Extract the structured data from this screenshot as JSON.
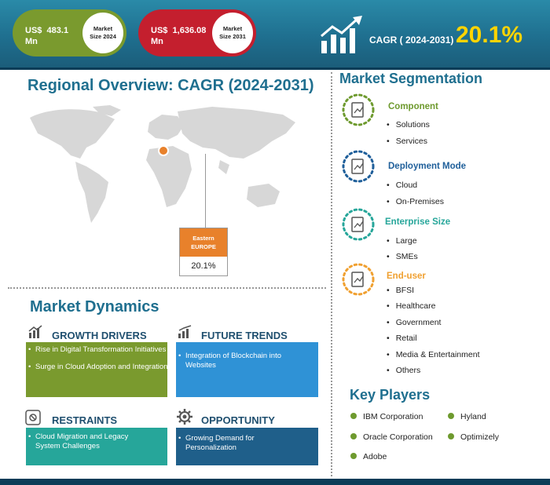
{
  "header": {
    "market_2024": {
      "currency": "US$",
      "value": "483.1",
      "unit": "Mn",
      "label_line1": "Market",
      "label_line2": "Size 2024"
    },
    "market_2031": {
      "currency": "US$",
      "value": "1,636.08",
      "unit": "Mn",
      "label_line1": "Market",
      "label_line2": "Size 2031"
    },
    "cagr_label": "CAGR ( 2024-2031)",
    "cagr_value": "20.1%"
  },
  "regional": {
    "title": "Regional Overview: CAGR (2024-2031)",
    "region_line1": "Eastern",
    "region_line2": "EUROPE",
    "region_cagr": "20.1%"
  },
  "dynamics": {
    "title": "Market Dynamics",
    "growth_drivers": {
      "heading": "GROWTH DRIVERS",
      "items": [
        "Rise in Digital Transformation Initiatives",
        "Surge in Cloud Adoption and Integration"
      ]
    },
    "future_trends": {
      "heading": "FUTURE TRENDS",
      "item_line1": "Integration of Blockchain into",
      "item_line2": "Websites"
    },
    "restraints": {
      "heading": "RESTRAINTS",
      "item_line1": "Cloud Migration and Legacy",
      "item_line2": "System Challenges"
    },
    "opportunity": {
      "heading": "OPPORTUNITY",
      "item_line1": "Growing Demand for",
      "item_line2": "Personalization"
    }
  },
  "segmentation": {
    "title": "Market Segmentation",
    "groups": [
      {
        "heading": "Component",
        "color": "#6e9a2e",
        "items": [
          "Solutions",
          "Services"
        ]
      },
      {
        "heading": "Deployment Mode",
        "color": "#1f5f9a",
        "items": [
          "Cloud",
          "On-Premises"
        ]
      },
      {
        "heading": "Enterprise Size",
        "color": "#26a69a",
        "items": [
          "Large",
          "SMEs"
        ]
      },
      {
        "heading": "End-user",
        "color": "#f0a030",
        "items": [
          "BFSI",
          "Healthcare",
          "Government",
          "Retail",
          "Media & Entertainment",
          "Others"
        ]
      }
    ]
  },
  "key_players": {
    "title": "Key Players",
    "items": [
      "IBM Corporation",
      "Oracle Corporation",
      "Adobe",
      "Hyland",
      "Optimizely"
    ]
  },
  "colors": {
    "header_teal": "#1f6f8f",
    "green": "#7a9a2e",
    "red": "#c41f2e",
    "orange": "#e8812b",
    "blue": "#2f92d6",
    "teal": "#26a69a",
    "navy": "#1f5f8a",
    "yellow": "#ffd400"
  }
}
